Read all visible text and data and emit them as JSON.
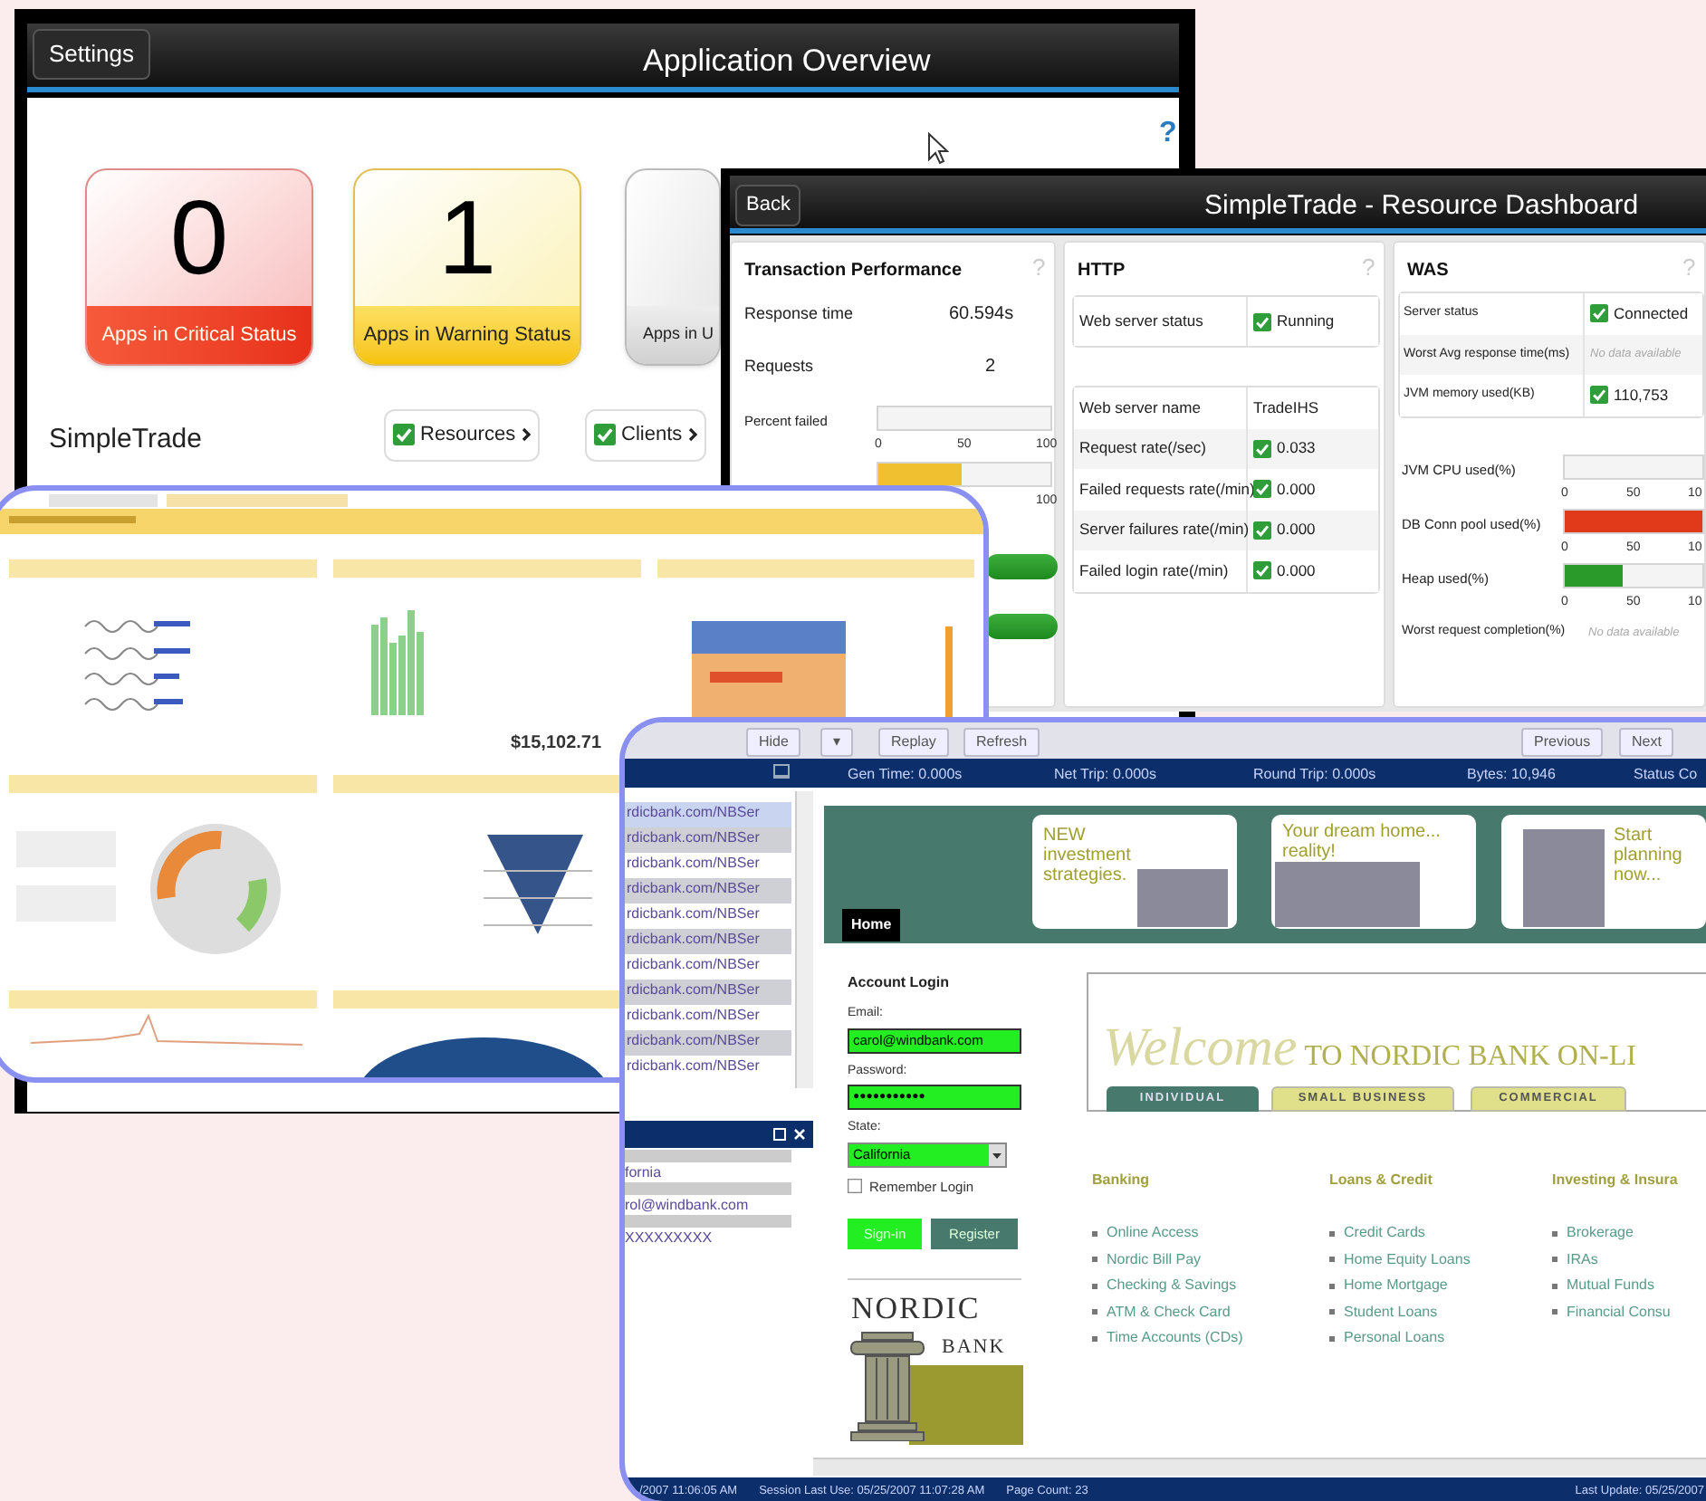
{
  "overview": {
    "settings_button": "Settings",
    "title": "Application Overview",
    "help": "?",
    "status_cards": [
      {
        "kind": "critical",
        "count": "0",
        "label": "Apps in Critical Status"
      },
      {
        "kind": "warning",
        "count": "1",
        "label": "Apps in Warning Status"
      },
      {
        "kind": "unknown",
        "label": "Apps in U"
      }
    ],
    "app": {
      "name": "SimpleTrade",
      "links": [
        {
          "label": "Resources",
          "checked": true
        },
        {
          "label": "Clients",
          "checked": true
        }
      ]
    }
  },
  "resource_dashboard": {
    "back_button": "Back",
    "title": "SimpleTrade - Resource Dashboard",
    "transaction_performance": {
      "title": "Transaction Performance",
      "help": "?",
      "rows": [
        {
          "kind": "value",
          "label": "Response time",
          "value": "60.594s"
        },
        {
          "kind": "value",
          "label": "Requests",
          "value": "2"
        },
        {
          "kind": "meter",
          "label": "Percent failed",
          "ticks": [
            "0",
            "50",
            "100"
          ]
        },
        {
          "kind": "meter",
          "level": 0.48,
          "color": "#f0c030",
          "ticks": [
            "100"
          ]
        }
      ]
    },
    "http": {
      "title": "HTTP",
      "help": "?",
      "tables": [
        [
          {
            "kind": "status",
            "label": "Web server status",
            "value": "Running",
            "checked": true
          }
        ],
        [
          {
            "kind": "text",
            "label": "Web server name",
            "value": "TradeIHS"
          },
          {
            "kind": "status",
            "label": "Request rate(/sec)",
            "value": "0.033",
            "checked": true
          },
          {
            "kind": "status",
            "label": "Failed requests rate(/min)",
            "value": "0.000",
            "checked": true
          },
          {
            "kind": "status",
            "label": "Server failures rate(/min)",
            "value": "0.000",
            "checked": true
          },
          {
            "kind": "status",
            "label": "Failed login rate(/min)",
            "value": "0.000",
            "checked": true
          }
        ]
      ]
    },
    "was": {
      "title": "WAS",
      "help": "?",
      "table": [
        {
          "kind": "status",
          "label": "Server status",
          "value": "Connected",
          "checked": true
        },
        {
          "kind": "nodata",
          "label": "Worst Avg response time(ms)",
          "value": "No data available"
        },
        {
          "kind": "status",
          "label": "JVM memory used(KB)",
          "value": "110,753",
          "checked": true
        }
      ],
      "meters": [
        {
          "kind": "meter",
          "label": "JVM CPU used(%)",
          "ticks": [
            "0",
            "50",
            "10"
          ]
        },
        {
          "kind": "meter",
          "label": "DB Conn pool used(%)",
          "level": 1,
          "color": "#e03a1a",
          "ticks": [
            "0",
            "50",
            "10"
          ]
        },
        {
          "kind": "meter",
          "label": "Heap used(%)",
          "level": 0.42,
          "color": "#2a9a2a",
          "ticks": [
            "0",
            "50",
            "10"
          ]
        },
        {
          "kind": "nodata",
          "label": "Worst request completion(%)",
          "value": "No data available"
        }
      ]
    }
  },
  "executive_dashboard": {
    "sales_today": "$15,102.71"
  },
  "session_replay": {
    "toolbar": [
      "Hide",
      "▾",
      "Replay",
      "Refresh"
    ],
    "toolbar_right": [
      "Previous",
      "Next"
    ],
    "stats": [
      "Gen Time: 0.000s",
      "Net Trip: 0.000s",
      "Round Trip: 0.000s",
      "Bytes: 10,946",
      "Status Co"
    ],
    "urls": [
      {
        "text": "rdicbank.com/NBSer",
        "selected": true
      },
      {
        "text": "rdicbank.com/NBSer",
        "selected": false
      },
      {
        "text": "rdicbank.com/NBSer",
        "selected": false
      },
      {
        "text": "rdicbank.com/NBSer",
        "selected": false
      },
      {
        "text": "rdicbank.com/NBSer",
        "selected": false
      },
      {
        "text": "rdicbank.com/NBSer",
        "selected": false
      },
      {
        "text": "rdicbank.com/NBSer",
        "selected": false
      },
      {
        "text": "rdicbank.com/NBSer",
        "selected": false
      },
      {
        "text": "rdicbank.com/NBSer",
        "selected": false
      },
      {
        "text": "rdicbank.com/NBSer",
        "selected": false
      },
      {
        "text": "rdicbank.com/NBSer",
        "selected": false
      }
    ],
    "form_values": [
      "fornia",
      "rol@windbank.com",
      "XXXXXXXXX"
    ],
    "status_bar": [
      "/2007 11:06:05 AM",
      "Session Last Use: 05/25/2007 11:07:28 AM",
      "Page Count: 23",
      "Last Update: 05/25/2007"
    ],
    "bank_page": {
      "home_tab": "Home",
      "ads": [
        {
          "headline": "NEW investment strategies."
        },
        {
          "headline": "Your dream home... reality!"
        },
        {
          "headline": "Start planning now..."
        }
      ],
      "login": {
        "title": "Account Login",
        "email_label": "Email:",
        "email": "carol@windbank.com",
        "password_label": "Password:",
        "password": "●●●●●●●●●●●",
        "state_label": "State:",
        "state": "California",
        "remember": {
          "label": "Remember Login",
          "checked": false
        },
        "buttons": [
          "Sign-in",
          "Register"
        ]
      },
      "logo": {
        "line1": "NORDIC",
        "line2": "BANK"
      },
      "welcome": {
        "script": "Welcome",
        "rest": "TO NORDIC BANK ON-LI"
      },
      "tabs": [
        {
          "label": "INDIVIDUAL",
          "selected": true
        },
        {
          "label": "SMALL BUSINESS",
          "selected": false
        },
        {
          "label": "COMMERCIAL",
          "selected": false
        }
      ],
      "columns": [
        {
          "heading": "Banking",
          "links": [
            "Online Access",
            "Nordic Bill Pay",
            "Checking & Savings",
            "ATM & Check Card",
            "Time Accounts (CDs)"
          ]
        },
        {
          "heading": "Loans & Credit",
          "links": [
            "Credit Cards",
            "Home Equity Loans",
            "Home Mortgage",
            "Student Loans",
            "Personal Loans"
          ]
        },
        {
          "heading": "Investing & Insura",
          "links": [
            "Brokerage",
            "IRAs",
            "Mutual Funds",
            "Financial Consu"
          ]
        }
      ]
    }
  }
}
